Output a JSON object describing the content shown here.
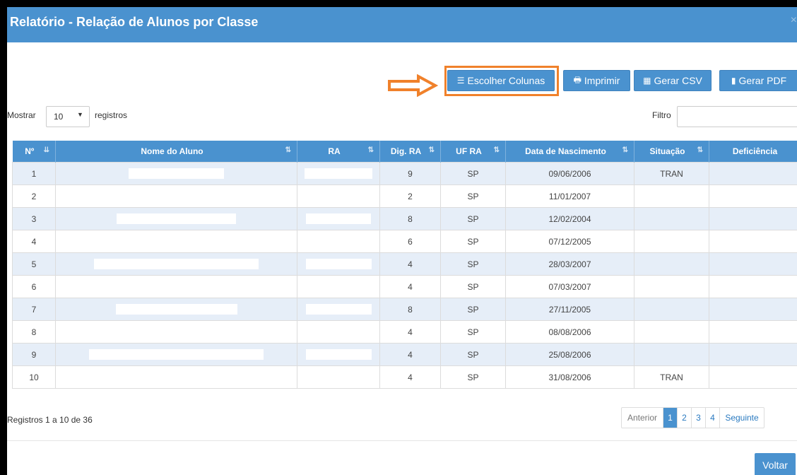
{
  "modal": {
    "title": "Relatório - Relação de Alunos por Classe",
    "close_symbol": "×"
  },
  "toolbar": {
    "choose_columns": "Escolher Colunas",
    "print": "Imprimir",
    "csv": "Gerar CSV",
    "pdf": "Gerar PDF",
    "highlight_color": "#f0812b"
  },
  "length": {
    "label_before": "Mostrar",
    "value": "10",
    "label_after": "registros"
  },
  "filter": {
    "label": "Filtro",
    "value": ""
  },
  "table": {
    "columns": [
      "Nº",
      "Nome do Aluno",
      "RA",
      "Dig. RA",
      "UF RA",
      "Data de Nascimento",
      "Situação",
      "Deficiência"
    ],
    "rows": [
      {
        "n": "1",
        "nome": "",
        "ra": "",
        "dig": "9",
        "uf": "SP",
        "nasc": "09/06/2006",
        "sit": "TRAN",
        "def": ""
      },
      {
        "n": "2",
        "nome": "",
        "ra": "",
        "dig": "2",
        "uf": "SP",
        "nasc": "11/01/2007",
        "sit": "",
        "def": ""
      },
      {
        "n": "3",
        "nome": "",
        "ra": "",
        "dig": "8",
        "uf": "SP",
        "nasc": "12/02/2004",
        "sit": "",
        "def": ""
      },
      {
        "n": "4",
        "nome": "",
        "ra": "",
        "dig": "6",
        "uf": "SP",
        "nasc": "07/12/2005",
        "sit": "",
        "def": ""
      },
      {
        "n": "5",
        "nome": "",
        "ra": "",
        "dig": "4",
        "uf": "SP",
        "nasc": "28/03/2007",
        "sit": "",
        "def": ""
      },
      {
        "n": "6",
        "nome": "",
        "ra": "",
        "dig": "4",
        "uf": "SP",
        "nasc": "07/03/2007",
        "sit": "",
        "def": ""
      },
      {
        "n": "7",
        "nome": "",
        "ra": "",
        "dig": "8",
        "uf": "SP",
        "nasc": "27/11/2005",
        "sit": "",
        "def": ""
      },
      {
        "n": "8",
        "nome": "",
        "ra": "",
        "dig": "4",
        "uf": "SP",
        "nasc": "08/08/2006",
        "sit": "",
        "def": ""
      },
      {
        "n": "9",
        "nome": "",
        "ra": "",
        "dig": "4",
        "uf": "SP",
        "nasc": "25/08/2006",
        "sit": "",
        "def": ""
      },
      {
        "n": "10",
        "nome": "",
        "ra": "",
        "dig": "4",
        "uf": "SP",
        "nasc": "31/08/2006",
        "sit": "TRAN",
        "def": ""
      }
    ]
  },
  "info": "Registros 1 a 10 de 36",
  "pagination": {
    "prev": "Anterior",
    "pages": [
      "1",
      "2",
      "3",
      "4"
    ],
    "active": "1",
    "next": "Seguinte"
  },
  "footer": {
    "back": "Voltar"
  }
}
